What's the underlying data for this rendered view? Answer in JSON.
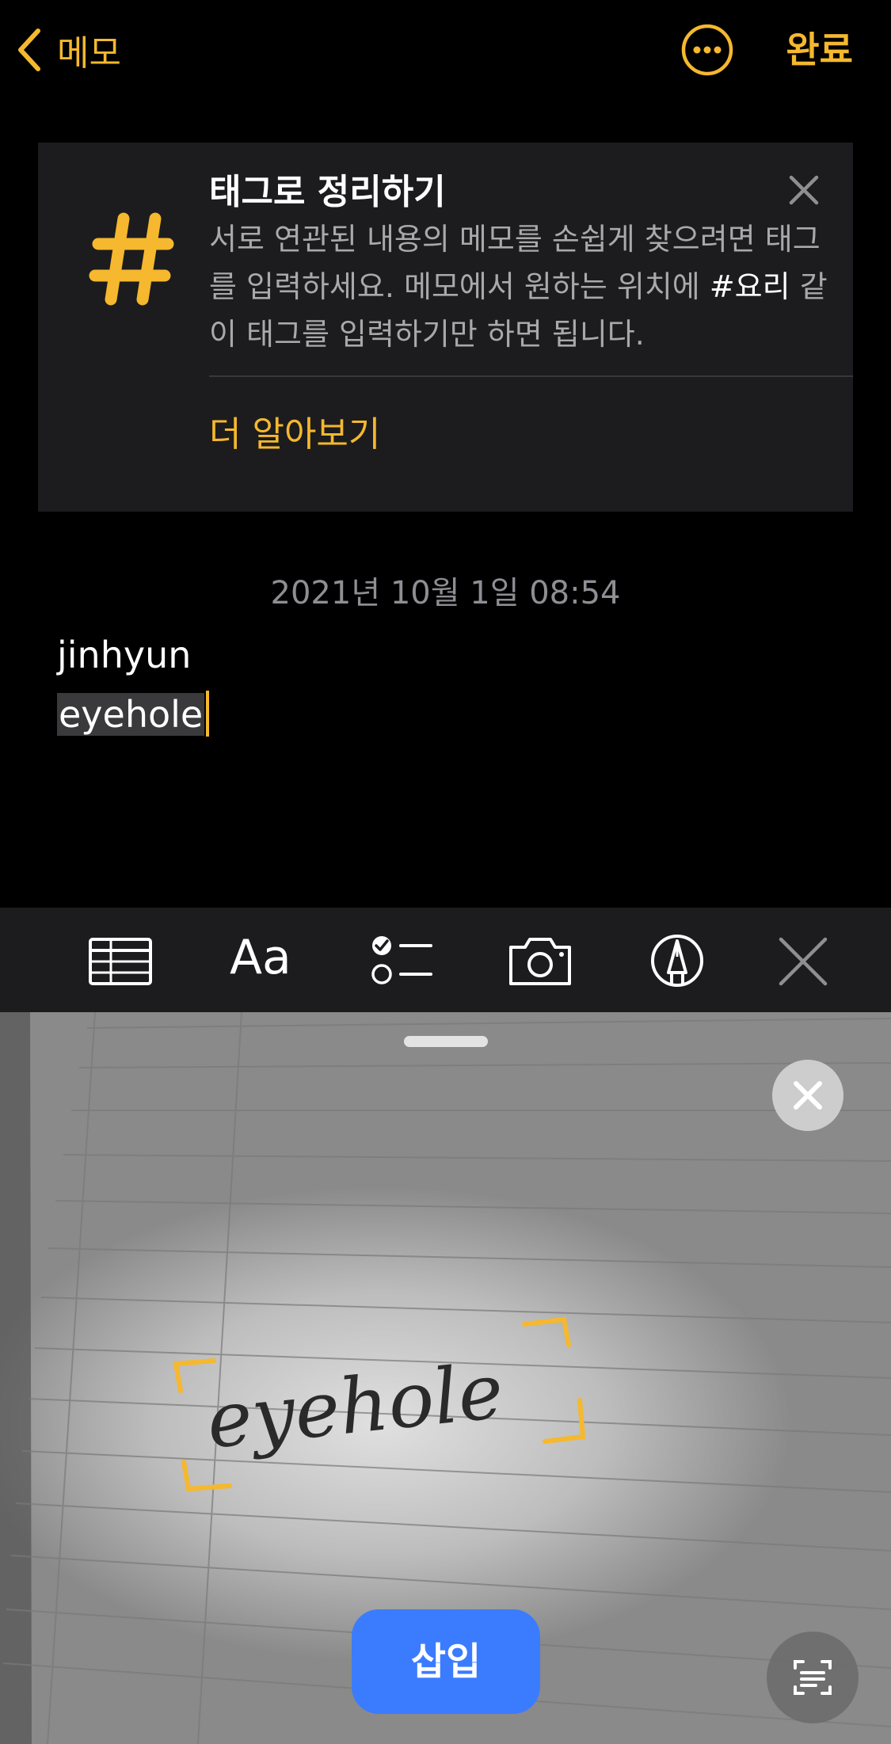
{
  "nav": {
    "back_label": "메모",
    "done_label": "완료",
    "back_icon": "chevron-left-icon",
    "more_icon": "ellipsis-circle-icon"
  },
  "tip_card": {
    "title": "태그로 정리하기",
    "body_part1": "서로 연관된 내용의 메모를 손쉽게 찾으려면 태그를 입력하세요. 메모에서 원하는 위치에 ",
    "tag_example": "#요리",
    "body_part2": " 같이 태그를 입력하기만 하면 됩니다.",
    "learn_more": "더 알아보기",
    "icon": "hashtag-icon"
  },
  "note": {
    "date": "2021년 10월 1일 08:54",
    "lines": [
      "jinhyun",
      "eyehole"
    ]
  },
  "toolbar": {
    "format_label": "Aa",
    "icons": [
      "table-icon",
      "format-icon",
      "checklist-icon",
      "camera-icon",
      "markup-pen-icon",
      "close-icon"
    ]
  },
  "camera_view": {
    "recognized_text": "eyehole",
    "insert_label": "삽입",
    "scan_icon": "text-scan-icon"
  },
  "colors": {
    "accent": "#F5B82E",
    "background": "#000000",
    "card": "#1c1c1e",
    "button_blue": "#3b7cff"
  }
}
